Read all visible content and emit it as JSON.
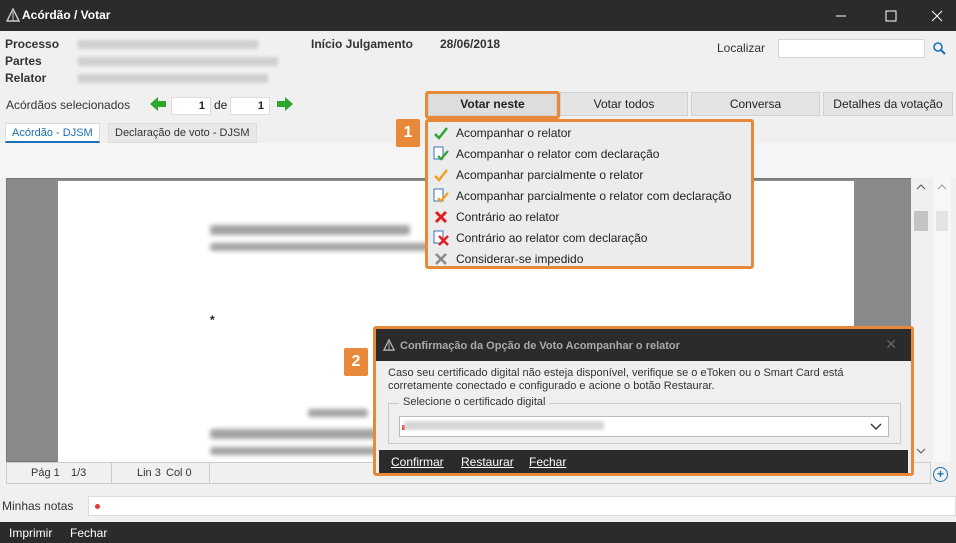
{
  "window": {
    "title": "Acórdão / Votar"
  },
  "header": {
    "processo_label": "Processo",
    "partes_label": "Partes",
    "relator_label": "Relator",
    "inicio_label": "Início Julgamento",
    "inicio_date": "28/06/2018",
    "localizar_label": "Localizar"
  },
  "selection": {
    "label": "Acórdãos selecionados",
    "current": "1",
    "de_label": "de",
    "total": "1"
  },
  "tabs": [
    {
      "label": "Votar neste"
    },
    {
      "label": "Votar todos"
    },
    {
      "label": "Conversa"
    },
    {
      "label": "Detalhes da votação"
    }
  ],
  "doc_tabs": [
    {
      "label": "Acórdão - DJSM"
    },
    {
      "label": "Declaração de voto - DJSM"
    }
  ],
  "status": {
    "page": "Pág 1",
    "pages": "1/3",
    "line": "Lin 3",
    "col": "Col 0"
  },
  "notes": {
    "label": "Minhas notas"
  },
  "bottom": {
    "print": "Imprimir",
    "close": "Fechar"
  },
  "annotations": {
    "menu_badge": "1",
    "dialog_badge": "2"
  },
  "vote_menu": {
    "items": [
      {
        "label": "Acompanhar o relator",
        "icon": "green-check-icon"
      },
      {
        "label": "Acompanhar o relator com declaração",
        "icon": "doc-green-check-icon"
      },
      {
        "label": "Acompanhar parcialmente o relator",
        "icon": "orange-check-icon"
      },
      {
        "label": "Acompanhar parcialmente o relator com declaração",
        "icon": "doc-orange-check-icon"
      },
      {
        "label": "Contrário ao relator",
        "icon": "red-x-icon"
      },
      {
        "label": "Contrário ao relator com declaração",
        "icon": "doc-red-x-icon"
      },
      {
        "label": "Considerar-se impedido",
        "icon": "gray-x-icon"
      }
    ]
  },
  "dialog": {
    "title": "Confirmação da Opção de Voto Acompanhar o relator",
    "message": "Caso seu certificado digital não esteja disponível, verifique se o eToken ou o Smart Card está corretamente conectado e configurado e acione o botão Restaurar.",
    "group_label": "Selecione o certificado digital",
    "confirm": "Confirmar",
    "restore": "Restaurar",
    "close": "Fechar"
  },
  "colors": {
    "accent": "#e8893a",
    "titlebar": "#2b2b2b",
    "link": "#1a6fb5"
  }
}
